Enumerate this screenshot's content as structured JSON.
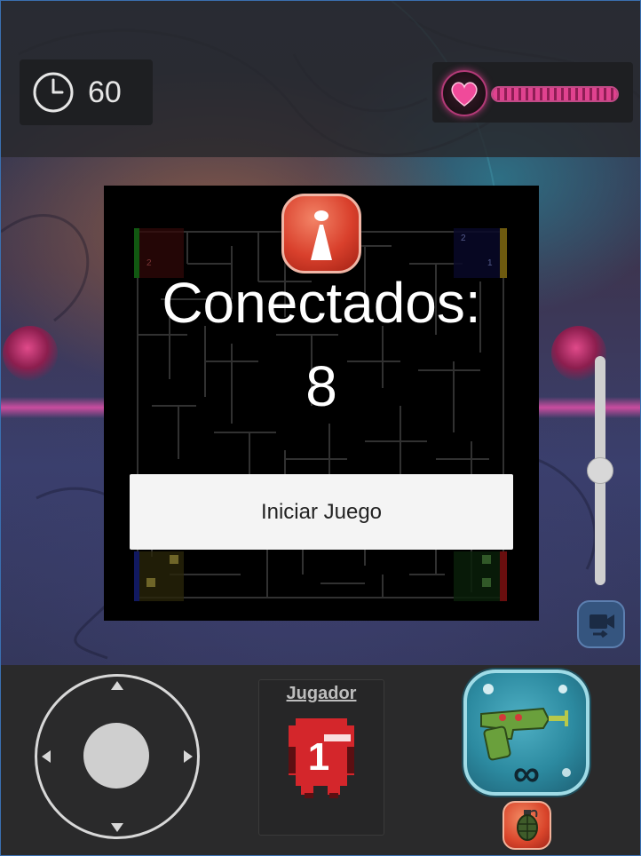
{
  "timer": {
    "icon": "clock-icon",
    "value": "60"
  },
  "health": {
    "icon": "heart-icon",
    "level": 1.0,
    "color": "#e0428f"
  },
  "lobby": {
    "title": "Conectados:",
    "count": "8",
    "info_icon": "info-icon",
    "start_button": "Iniciar Juego"
  },
  "maze": {
    "corner_numbers": [
      "2",
      "2",
      "1"
    ]
  },
  "controls": {
    "joystick_icon": "joystick",
    "camera_icon": "camera-switch-icon",
    "zoom_level": 0.5
  },
  "player": {
    "label": "Jugador",
    "number": "1",
    "color": "#d4262b"
  },
  "weapon": {
    "icon": "ray-gun-icon",
    "ammo": "∞",
    "secondary_icon": "grenade-icon"
  }
}
